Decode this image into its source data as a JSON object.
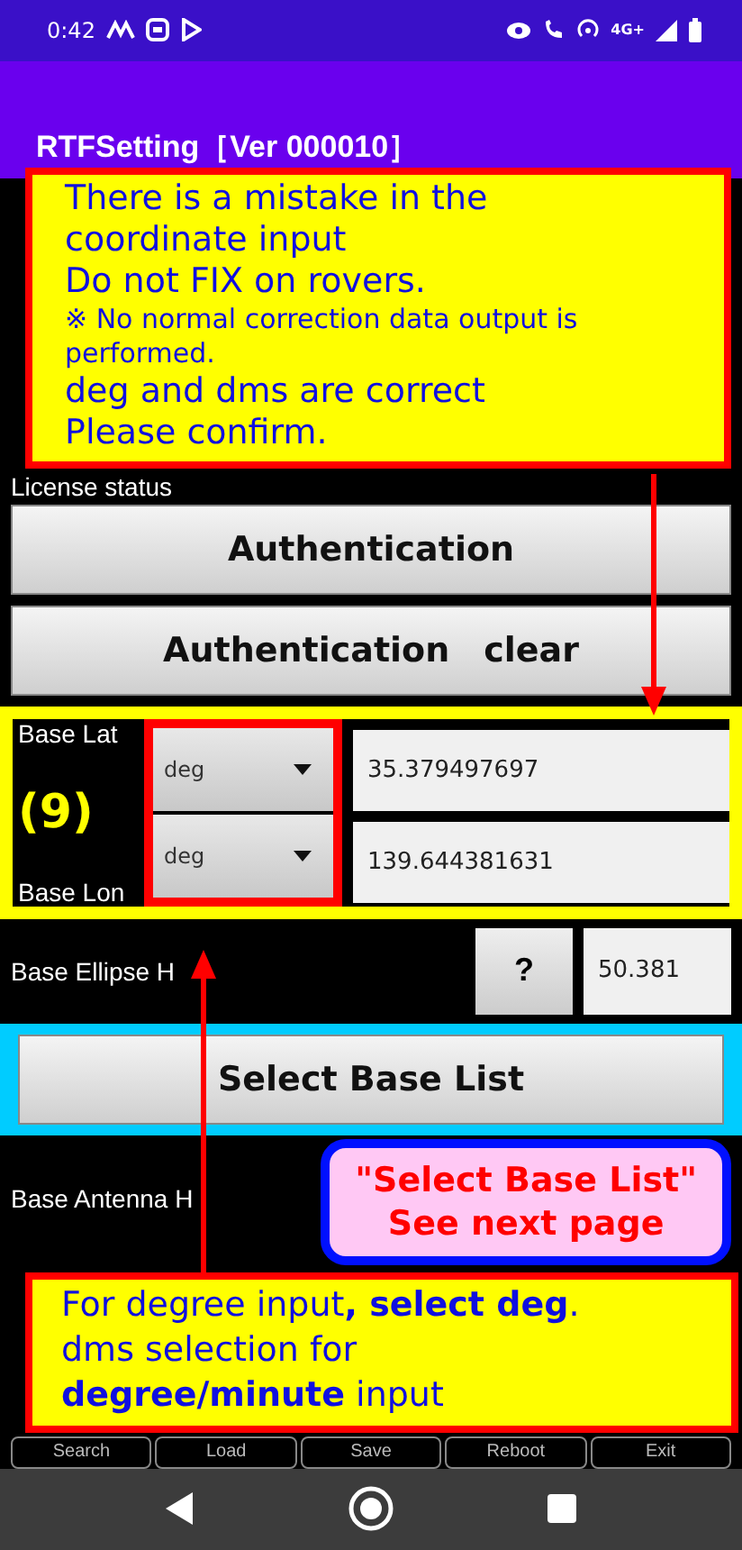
{
  "status_bar": {
    "time": "0:42",
    "network": "4G+"
  },
  "app_bar": {
    "title": "RTFSetting［Ver 000010］"
  },
  "license_status_label": "License status",
  "auth_buttons": [
    "Authentication",
    "Authentication　clear"
  ],
  "base_coordinates": [
    {
      "label": "Base Lat",
      "unit": "deg",
      "value": "35.379497697"
    },
    {
      "label": "Base Lon",
      "unit": "deg",
      "value": "139.644381631"
    }
  ],
  "ellipse": {
    "label": "Base Ellipse H",
    "help": "?",
    "value": "50.381"
  },
  "select_base_button": "Select Base List",
  "antenna_label": "Base Antenna H",
  "toolbar": [
    "Search",
    "Load",
    "Save",
    "Reboot",
    "Exit"
  ],
  "annotations": {
    "top_note": [
      "There is a mistake in the",
      "coordinate input",
      "Do not FIX on rovers.",
      "※ No normal correction data output is performed.",
      "deg and dms are correct",
      "Please confirm."
    ],
    "region_number": "(9)",
    "side_note": [
      "\"Select Base List\"",
      "See next page"
    ],
    "bottom_note": [
      "For degree input**, select deg**.",
      "dms selection for",
      "**degree/minute** input"
    ]
  }
}
